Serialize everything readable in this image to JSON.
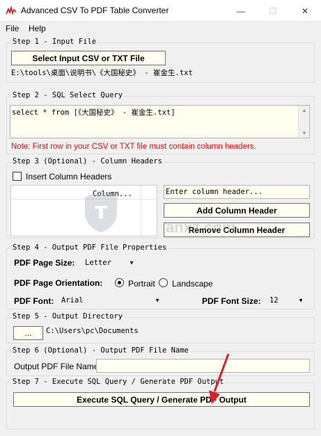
{
  "window": {
    "title": "Advanced CSV To PDF Table Converter",
    "minimize": "—",
    "maximize": "☐",
    "close": "✕"
  },
  "menu": {
    "file": "File",
    "help": "Help"
  },
  "step1": {
    "legend": "Step 1 - Input File",
    "button": "Select Input CSV or TXT File",
    "path": "E:\\tools\\桌面\\说明书\\《大国秘史》 - 崔金生.txt"
  },
  "step2": {
    "legend": "Step 2 - SQL Select Query",
    "query": "select * from [《大国秘史》 - 崔金生.txt]",
    "note": "Note: First row in your CSV or TXT file must contain column headers.",
    "note_color": "#ff0000"
  },
  "step3": {
    "legend": "Step 3 (Optional) - Column Headers",
    "checkbox_label": "Insert Column Headers",
    "list_header": "Column...",
    "header_placeholder": "Enter column header...",
    "add_button": "Add Column Header",
    "remove_button": "Remove Column Header"
  },
  "step4": {
    "legend": "Step 4 - Output PDF File Properties",
    "page_size_label": "PDF Page Size:",
    "page_size_value": "Letter",
    "orientation_label": "PDF Page Orientation:",
    "portrait": "Portrait",
    "landscape": "Landscape",
    "orientation_selected": "Portrait",
    "font_label": "PDF Font:",
    "font_value": "Arial",
    "font_size_label": "PDF Font Size:",
    "font_size_value": "12"
  },
  "step5": {
    "legend": "Step 5 - Output Directory",
    "browse": "...",
    "path": "C:\\Users\\pc\\Documents"
  },
  "step6": {
    "legend": "Step 6 (Optional) - Output PDF File Name",
    "label": "Output PDF File Name:",
    "value": ""
  },
  "step7": {
    "legend": "Step 7 - Execute SQL Query / Generate PDF Output",
    "button": "Execute SQL Query / Generate PDF Output"
  },
  "watermark": {
    "text": "anxz.com"
  },
  "colors": {
    "accent_red": "#e02020",
    "button_bg": "#fffff0"
  }
}
